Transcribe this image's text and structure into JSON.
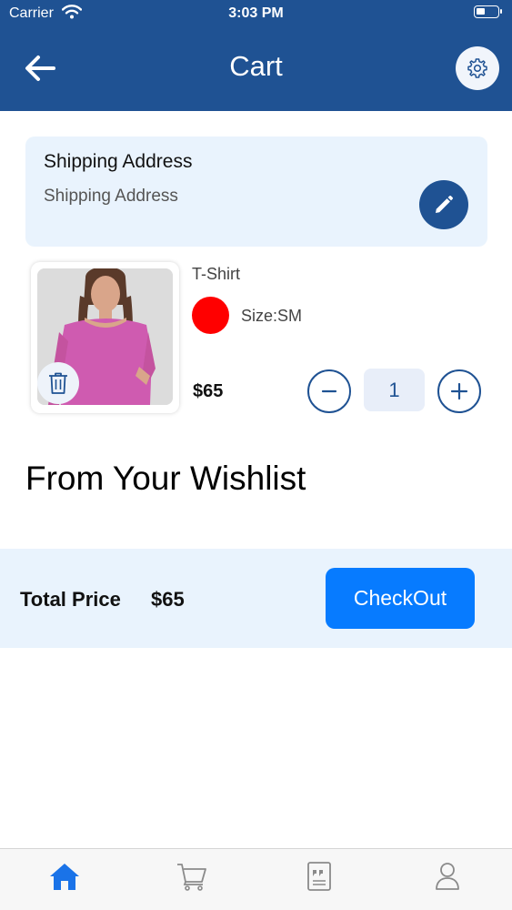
{
  "status_bar": {
    "carrier": "Carrier",
    "time": "3:03 PM"
  },
  "header": {
    "title": "Cart",
    "back_icon": "arrow-left-icon",
    "settings_icon": "gear-icon",
    "color": "#1f5293"
  },
  "shipping": {
    "title": "Shipping Address",
    "value": "Shipping Address",
    "edit_icon": "pencil-icon"
  },
  "cart_item": {
    "name": "T-Shirt",
    "color": "#ff0000",
    "size": "Size:SM",
    "price": "$65",
    "quantity": "1",
    "delete_icon": "trash-icon"
  },
  "wishlist": {
    "title": "From Your Wishlist"
  },
  "footer": {
    "total_label": "Total Price",
    "total_value": "$65",
    "checkout_label": "CheckOut",
    "checkout_color": "#077bff"
  },
  "tabbar": {
    "items": [
      {
        "icon": "home-icon",
        "active": true
      },
      {
        "icon": "cart-icon",
        "active": false
      },
      {
        "icon": "quote-doc-icon",
        "active": false
      },
      {
        "icon": "user-icon",
        "active": false
      }
    ],
    "active_color": "#1a73e8"
  }
}
